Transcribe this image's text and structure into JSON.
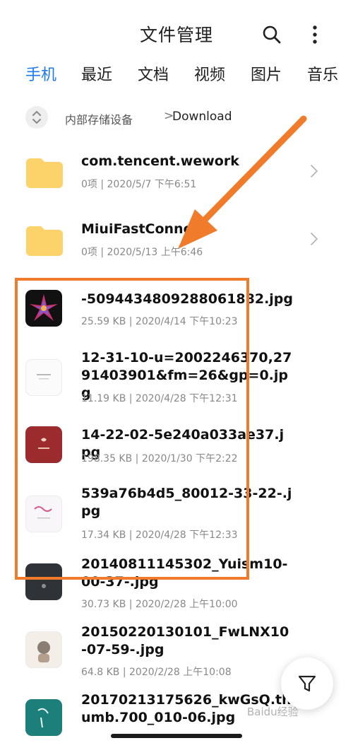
{
  "header": {
    "title": "文件管理"
  },
  "tabs": [
    {
      "label": "手机",
      "active": true
    },
    {
      "label": "最近",
      "active": false
    },
    {
      "label": "文档",
      "active": false
    },
    {
      "label": "视频",
      "active": false
    },
    {
      "label": "图片",
      "active": false
    },
    {
      "label": "音乐",
      "active": false
    }
  ],
  "breadcrumb": {
    "root": "内部存储设备",
    "separator": ">",
    "current": "Download"
  },
  "folders": [
    {
      "name": "com.tencent.wework",
      "meta": "0项 | 2020/5/7 下午6:51"
    },
    {
      "name": "MiuiFastConnect",
      "meta": "0项 | 2020/5/13 上午6:46"
    }
  ],
  "files": [
    {
      "name": "-5094434809288061882.jpg",
      "meta": "25.59 KB | 2020/4/14 下午10:23"
    },
    {
      "name": "12-31-10-u=2002246370,2791403901&fm=26&gp=0.jpg",
      "meta": "11.19 KB | 2020/4/28 下午12:31"
    },
    {
      "name": "14-22-02-5e240a033ae37.jpg",
      "meta": "198.35 KB | 2020/1/30 下午2:22"
    },
    {
      "name": "539a76b4d5_80012-33-22-.jpg",
      "meta": "17.34 KB | 2020/4/28 下午12:33"
    },
    {
      "name": "20140811145302_Yuism10-00-37-.jpg",
      "meta": "30.73 KB | 2020/2/28 上午10:00"
    },
    {
      "name": "20150220130101_FwLNX10-07-59-.jpg",
      "meta": "64.8 KB | 2020/2/28 上午10:08"
    },
    {
      "name": "20170213175626_kwGsQ.thumb.700_010-06.jpg",
      "meta": ""
    }
  ],
  "watermark": "Baidu经验",
  "colors": {
    "accent": "#1d7af0",
    "folder": "#fcd36a",
    "highlight": "#f07b2a"
  },
  "icons": [
    "search-icon",
    "more-vertical-icon",
    "expand-collapse-icon",
    "folder-icon",
    "chevron-right-icon",
    "filter-icon"
  ]
}
